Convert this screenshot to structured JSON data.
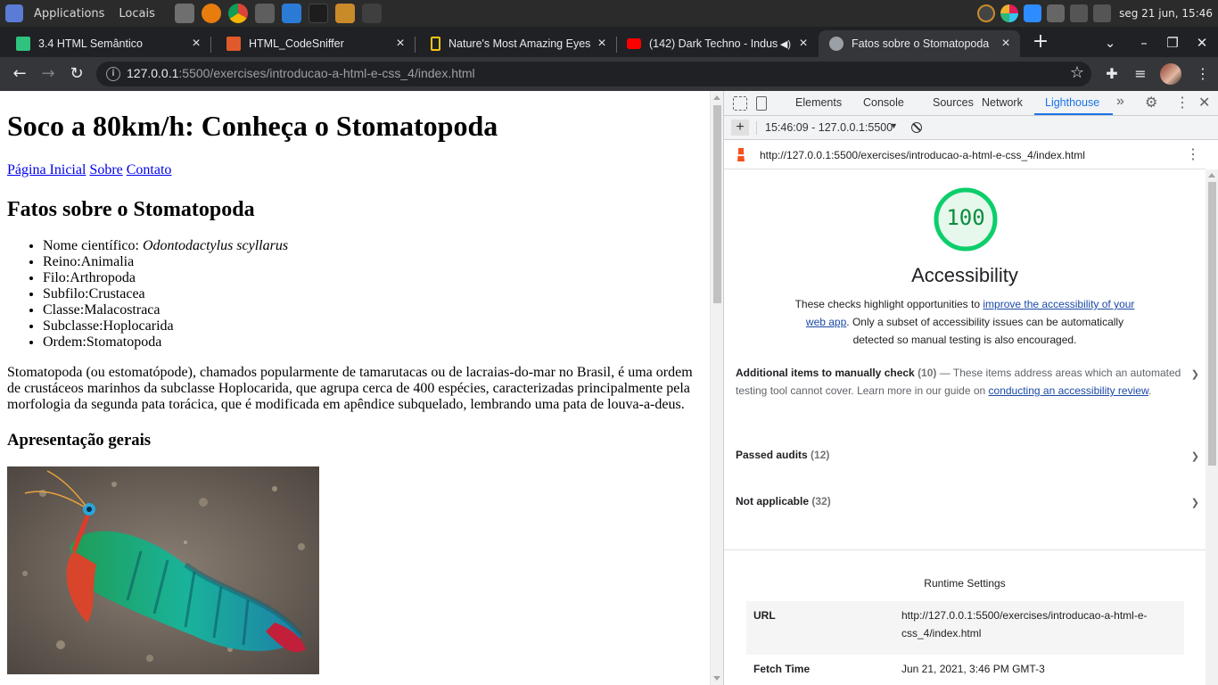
{
  "os_panel": {
    "menu_applications": "Applications",
    "menu_places": "Locais",
    "clock": "seg 21 jun, 15:46"
  },
  "tabs": [
    {
      "title": "3.4 HTML Semântico",
      "favicon_color": "#2ec27e",
      "icon": "document-icon"
    },
    {
      "title": "HTML_CodeSniffer",
      "favicon_color": "#e05a2b",
      "icon": "checkbox-icon"
    },
    {
      "title": "Nature's Most Amazing Eyes",
      "favicon_color": "#f5c518",
      "icon": "natgeo-icon"
    },
    {
      "title": "(142) Dark Techno - Indus",
      "favicon_color": "#ff0000",
      "icon": "youtube-icon"
    },
    {
      "title": "Fatos sobre o Stomatopoda",
      "favicon_color": "#9aa0a6",
      "icon": "globe-icon",
      "active": true
    }
  ],
  "toolbar": {
    "url_host": "127.0.0.1",
    "url_rest": ":5500/exercises/introducao-a-html-e-css_4/index.html"
  },
  "page": {
    "h1": "Soco a 80km/h: Conheça o Stomatopoda",
    "nav": [
      "Página Inicial",
      "Sobre",
      "Contato"
    ],
    "h2": "Fatos sobre o Stomatopoda",
    "facts": [
      {
        "label": "Nome científico: ",
        "value": "Odontodactylus scyllarus",
        "italic": true
      },
      {
        "label": "Reino:",
        "value": "Animalia"
      },
      {
        "label": "Filo:",
        "value": "Arthropoda"
      },
      {
        "label": "Subfilo:",
        "value": "Crustacea"
      },
      {
        "label": "Classe:",
        "value": "Malacostraca"
      },
      {
        "label": "Subclasse:",
        "value": "Hoplocarida"
      },
      {
        "label": "Ordem:",
        "value": "Stomatopoda"
      }
    ],
    "description": "Stomatopoda (ou estomatópode), chamados popularmente de tamarutacas ou de lacraias-do-mar no Brasil, é uma ordem de crustáceos marinhos da subclasse Hoplocarida, que agrupa cerca de 400 espécies, caracterizadas principalmente pela morfologia da segunda pata torácica, que é modificada em apêndice subquelado, lembrando uma pata de louva-a-deus.",
    "h3": "Apresentação gerais"
  },
  "devtools": {
    "tabs": [
      "Elements",
      "Console",
      "Sources",
      "Network",
      "Lighthouse"
    ],
    "active_tab": "Lighthouse",
    "report_selector": "15:46:09 - 127.0.0.1:5500",
    "report_url": "http://127.0.0.1:5500/exercises/introducao-a-html-e-css_4/index.html",
    "score": "100",
    "score_fraction": 1.0,
    "score_color": "#0cce6b",
    "category": "Accessibility",
    "desc_pre": "These checks highlight opportunities to ",
    "desc_link": "improve the accessibility of your web app",
    "desc_post": ". Only a subset of accessibility issues can be automatically detected so manual testing is also encouraged.",
    "groups": {
      "manual": {
        "title": "Additional items to manually check",
        "count": "(10)",
        "dash": " — ",
        "desc": "These items address areas which an automated testing tool cannot cover. Learn more in our guide on ",
        "link": "conducting an accessibility review",
        "end": "."
      },
      "passed": {
        "title": "Passed audits",
        "count": "(12)"
      },
      "na": {
        "title": "Not applicable",
        "count": "(32)"
      }
    },
    "runtime": {
      "title": "Runtime Settings",
      "rows": [
        {
          "key": "URL",
          "value": "http://127.0.0.1:5500/exercises/introducao-a-html-e-css_4/index.html"
        },
        {
          "key": "Fetch Time",
          "value": "Jun 21, 2021, 3:46 PM GMT-3"
        }
      ]
    }
  }
}
